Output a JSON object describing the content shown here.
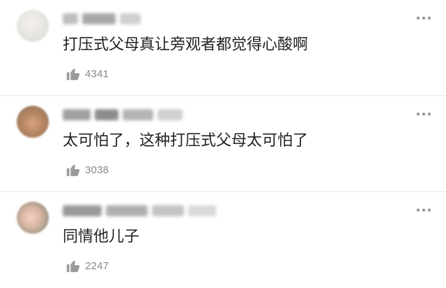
{
  "theme": {
    "text_color": "#222222",
    "meta_color": "#888888",
    "icon_color": "#9a9a9a",
    "divider_color": "#e6e6e6"
  },
  "icons": {
    "more": "more-dots-icon",
    "like": "thumbs-up-icon"
  },
  "comments": [
    {
      "text": "打压式父母真让旁观者都觉得心酸啊",
      "likes": "4341"
    },
    {
      "text": "太可怕了，这种打压式父母太可怕了",
      "likes": "3038"
    },
    {
      "text": "同情他儿子",
      "likes": "2247"
    }
  ]
}
